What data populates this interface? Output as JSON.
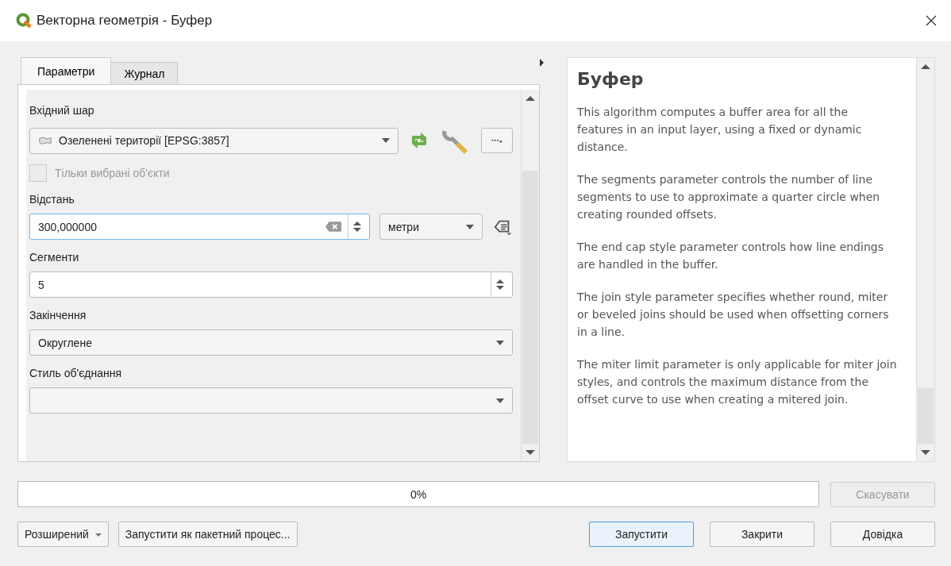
{
  "window": {
    "title": "Векторна геометрія - Буфер"
  },
  "tabs": [
    {
      "label": "Параметри",
      "selected": true
    },
    {
      "label": "Журнал",
      "selected": false
    }
  ],
  "params": [
    {
      "kind": "label",
      "text": "Вхідний шар"
    },
    {
      "kind": "layer",
      "value": "Озеленені території [EPSG:3857]"
    },
    {
      "kind": "checkbox",
      "label": "Тільки вибрані об'єкти",
      "checked": false,
      "disabled": true
    },
    {
      "kind": "label",
      "text": "Відстань"
    },
    {
      "kind": "distance",
      "value": "300,000000",
      "unit": "метри"
    },
    {
      "kind": "label",
      "text": "Сегменти"
    },
    {
      "kind": "spin",
      "value": "5"
    },
    {
      "kind": "label",
      "text": "Закінчення"
    },
    {
      "kind": "combo",
      "value": "Округлене"
    },
    {
      "kind": "label",
      "text": "Стиль об'єднання"
    },
    {
      "kind": "combo"
    }
  ],
  "help": {
    "title": "Буфер",
    "paragraphs": [
      "This algorithm computes a buffer area for all the features in an input layer, using a fixed or dynamic distance.",
      "The segments parameter controls the number of line segments to use to approximate a quarter circle when creating rounded offsets.",
      "The end cap style parameter controls how line endings are handled in the buffer.",
      "The join style parameter specifies whether round, miter or beveled joins should be used when offsetting corners in a line.",
      "The miter limit parameter is only applicable for miter join styles, and controls the maximum distance from the offset curve to use when creating a mitered join."
    ]
  },
  "progress": {
    "level": 0,
    "text": "0%"
  },
  "cancel_button": {
    "label": "Скасувати",
    "disabled": true
  },
  "buttons_left": [
    {
      "label": "Розширений",
      "kind": "menu"
    },
    {
      "label": "Запустити як пакетний процес...",
      "kind": "plain"
    }
  ],
  "buttons_right": [
    {
      "label": "Запустити",
      "default": true
    },
    {
      "label": "Закрити",
      "default": false
    },
    {
      "label": "Довідка",
      "default": false
    }
  ]
}
